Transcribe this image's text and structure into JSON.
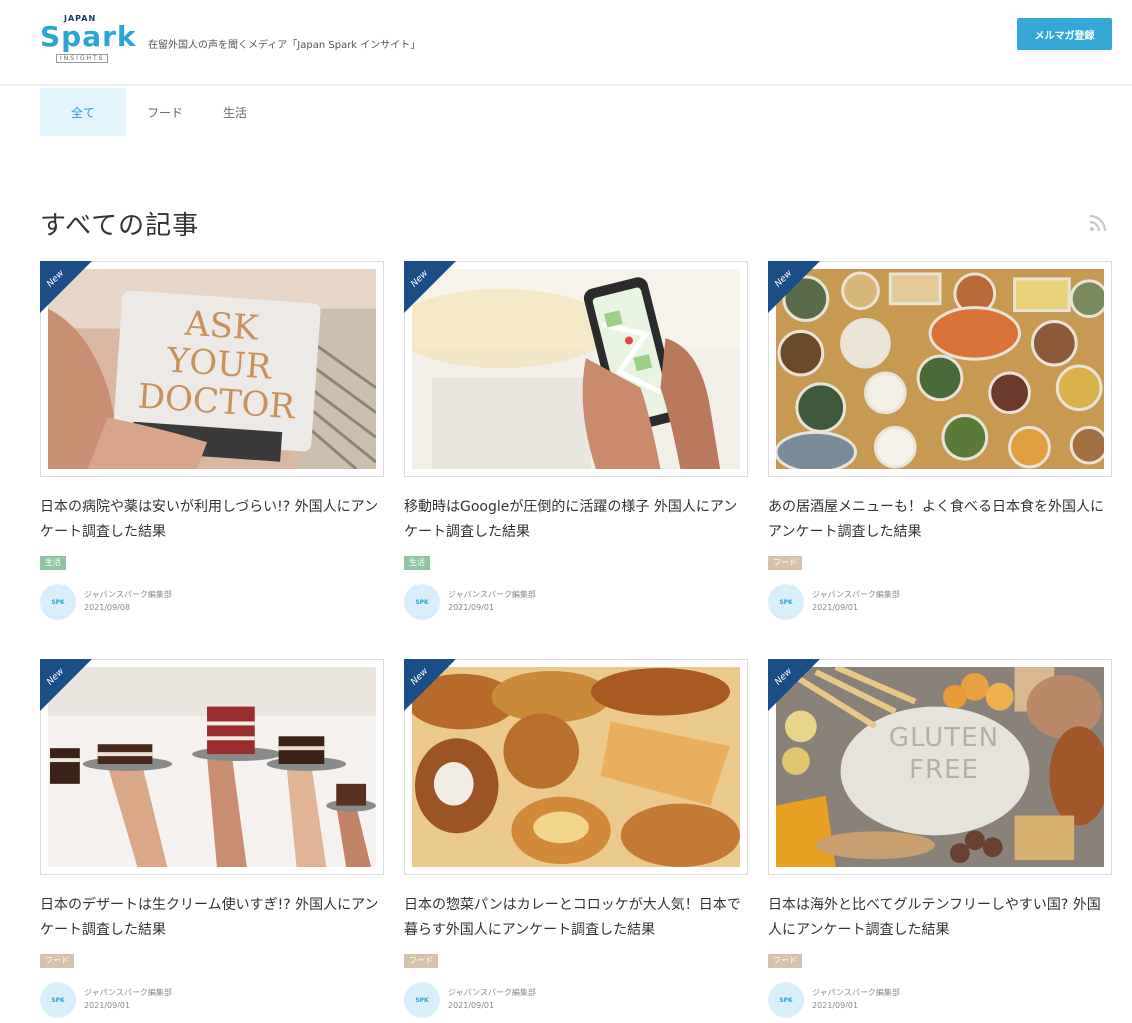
{
  "header": {
    "logo_japan": "JAPAN",
    "logo_spark": "Spark",
    "logo_insights": "INSIGHTS",
    "tagline": "在留外国人の声を聞くメディア「Japan Spark インサイト」",
    "newsletter_button": "メルマガ登録"
  },
  "tabs": [
    {
      "label": "全て",
      "active": true
    },
    {
      "label": "フード",
      "active": false
    },
    {
      "label": "生活",
      "active": false
    }
  ],
  "section_title": "すべての記事",
  "icons": {
    "rss": "rss-icon"
  },
  "new_badge": "New",
  "articles": [
    {
      "title": "日本の病院や薬は安いが利用しづらい!? 外国人にアンケート調査した結果",
      "tag": "生活",
      "author": "ジャパンスパーク編集部",
      "date": "2021/09/08",
      "avatar": "SPK",
      "thumb_caption": "ASK YOUR DOCTOR"
    },
    {
      "title": "移動時はGoogleが圧倒的に活躍の様子 外国人にアンケート調査した結果",
      "tag": "生活",
      "author": "ジャパンスパーク編集部",
      "date": "2021/09/01",
      "avatar": "SPK"
    },
    {
      "title": "あの居酒屋メニューも！よく食べる日本食を外国人にアンケート調査した結果",
      "tag": "フード",
      "author": "ジャパンスパーク編集部",
      "date": "2021/09/01",
      "avatar": "SPK"
    },
    {
      "title": "日本のデザートは生クリーム使いすぎ!? 外国人にアンケート調査した結果",
      "tag": "フード",
      "author": "ジャパンスパーク編集部",
      "date": "2021/09/01",
      "avatar": "SPK"
    },
    {
      "title": "日本の惣菜パンはカレーとコロッケが大人気！日本で暮らす外国人にアンケート調査した結果",
      "tag": "フード",
      "author": "ジャパンスパーク編集部",
      "date": "2021/09/01",
      "avatar": "SPK"
    },
    {
      "title": "日本は海外と比べてグルテンフリーしやすい国? 外国人にアンケート調査した結果",
      "tag": "フード",
      "author": "ジャパンスパーク編集部",
      "date": "2021/09/01",
      "avatar": "SPK",
      "thumb_caption": "GLUTEN FREE"
    }
  ]
}
